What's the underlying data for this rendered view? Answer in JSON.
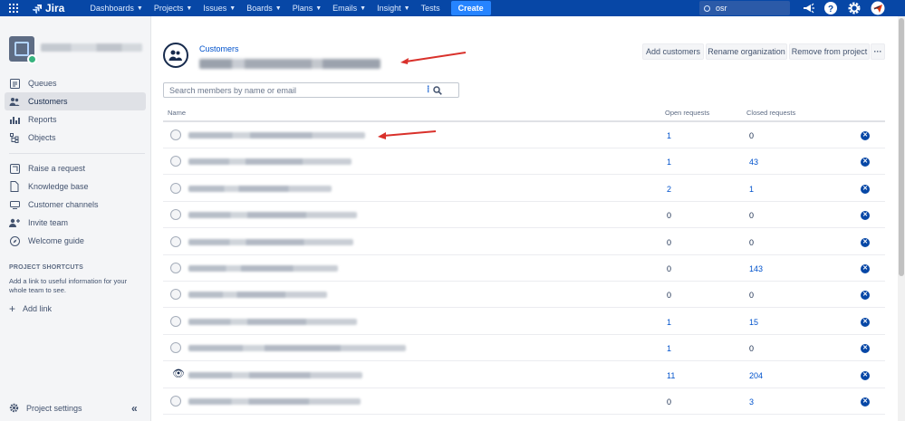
{
  "topnav": {
    "logo": "Jira",
    "items": [
      {
        "label": "Dashboards"
      },
      {
        "label": "Projects"
      },
      {
        "label": "Issues"
      },
      {
        "label": "Boards"
      },
      {
        "label": "Plans"
      },
      {
        "label": "Emails"
      },
      {
        "label": "Insight"
      },
      {
        "label": "Tests"
      }
    ],
    "create_label": "Create",
    "search_value": "osr",
    "icons": [
      "notifications-icon",
      "help-icon",
      "settings-icon",
      "user-avatar"
    ]
  },
  "sidebar": {
    "items": [
      {
        "label": "Queues",
        "icon": "queues-icon"
      },
      {
        "label": "Customers",
        "icon": "customers-icon"
      },
      {
        "label": "Reports",
        "icon": "reports-icon"
      },
      {
        "label": "Objects",
        "icon": "objects-icon"
      },
      {
        "label": "Raise a request",
        "icon": "raise-request-icon"
      },
      {
        "label": "Knowledge base",
        "icon": "knowledge-base-icon"
      },
      {
        "label": "Customer channels",
        "icon": "channels-icon"
      },
      {
        "label": "Invite team",
        "icon": "invite-team-icon"
      },
      {
        "label": "Welcome guide",
        "icon": "welcome-guide-icon"
      }
    ],
    "shortcuts_heading": "PROJECT SHORTCUTS",
    "shortcuts_text": "Add a link to useful information for your whole team to see.",
    "add_link": "Add link",
    "project_settings": "Project settings"
  },
  "main": {
    "breadcrumb": "Customers",
    "buttons": {
      "add_customers": "Add customers",
      "rename_org": "Rename organization",
      "remove_from_project": "Remove from project",
      "more": "···"
    },
    "search_placeholder": "Search members by name or email",
    "columns": {
      "name": "Name",
      "open": "Open requests",
      "closed": "Closed requests"
    },
    "rows": [
      {
        "open": "1",
        "open_link": true,
        "closed": "0",
        "closed_link": false
      },
      {
        "open": "1",
        "open_link": true,
        "closed": "43",
        "closed_link": true
      },
      {
        "open": "2",
        "open_link": true,
        "closed": "1",
        "closed_link": true
      },
      {
        "open": "0",
        "open_link": false,
        "closed": "0",
        "closed_link": false
      },
      {
        "open": "0",
        "open_link": false,
        "closed": "0",
        "closed_link": false
      },
      {
        "open": "0",
        "open_link": false,
        "closed": "143",
        "closed_link": true
      },
      {
        "open": "0",
        "open_link": false,
        "closed": "0",
        "closed_link": false
      },
      {
        "open": "1",
        "open_link": true,
        "closed": "15",
        "closed_link": true
      },
      {
        "open": "1",
        "open_link": true,
        "closed": "0",
        "closed_link": false
      },
      {
        "open": "11",
        "open_link": true,
        "closed": "204",
        "closed_link": true
      },
      {
        "open": "0",
        "open_link": false,
        "closed": "3",
        "closed_link": true
      }
    ]
  },
  "colors": {
    "nav": "#0747a6",
    "accent": "#0052cc",
    "annotation_arrow": "#d9312b"
  }
}
